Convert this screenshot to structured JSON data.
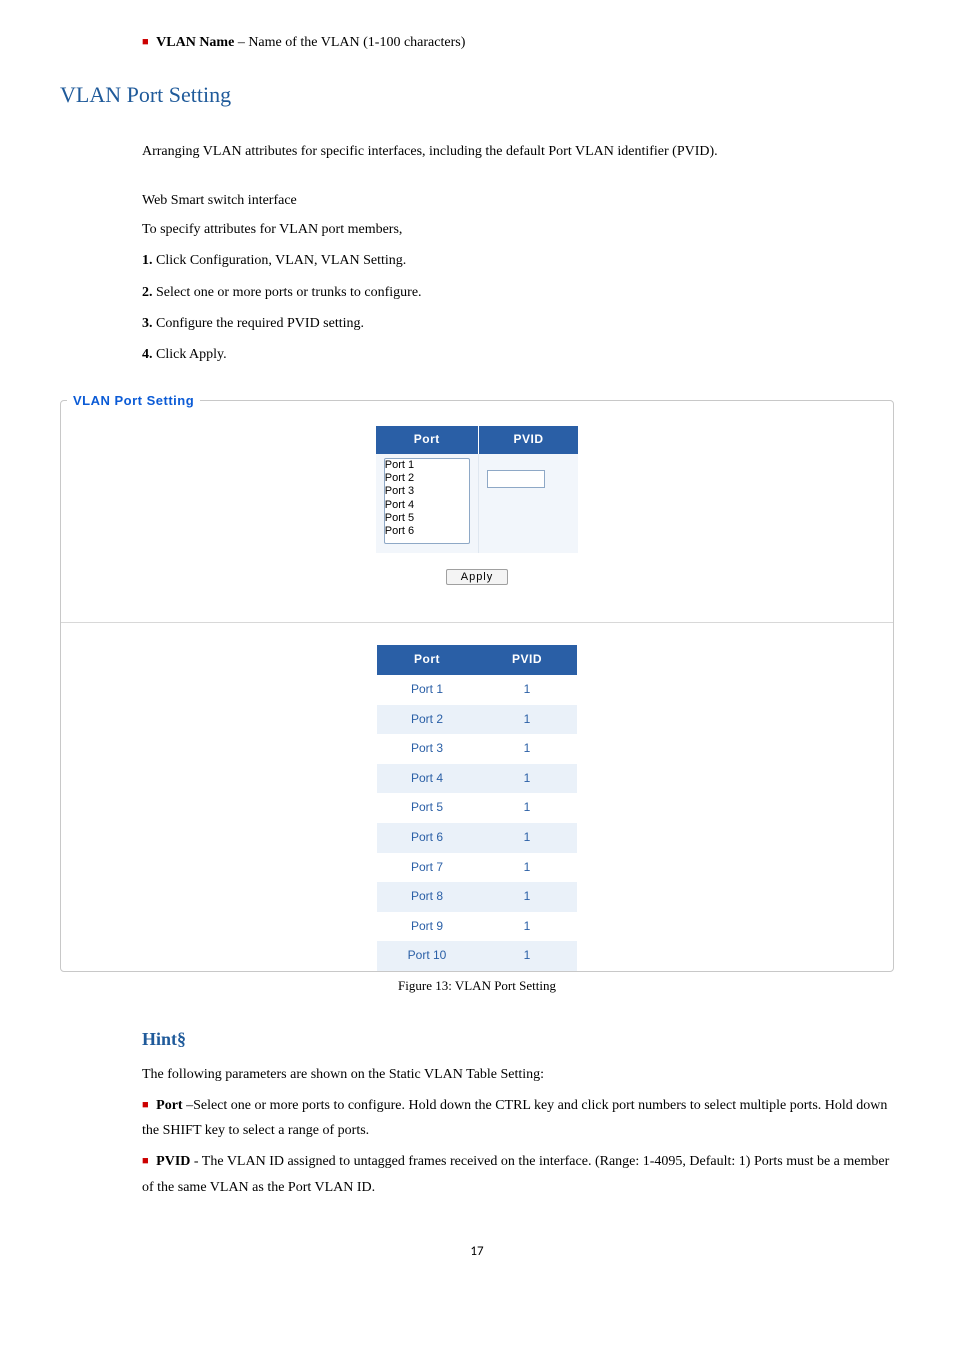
{
  "top_bullet": {
    "prefix": "■",
    "label": "VLAN Name",
    "desc": " – Name of the VLAN (1-100 characters)"
  },
  "section_title": "VLAN Port Setting",
  "intro": "Arranging VLAN attributes for specific interfaces, including the default Port VLAN identifier (PVID).",
  "sub_intro": "Web Smart switch interface",
  "sub_intro2": "To specify attributes for VLAN port members,",
  "steps": [
    {
      "n": "1.",
      "t": " Click Configuration, VLAN, VLAN Setting."
    },
    {
      "n": "2.",
      "t": " Select one or more ports or trunks to configure."
    },
    {
      "n": "3.",
      "t": " Configure the required PVID setting."
    },
    {
      "n": "4.",
      "t": " Click Apply."
    }
  ],
  "fieldset_legend": "VLAN Port Setting",
  "form_headers": {
    "port": "Port",
    "pvid": "PVID"
  },
  "port_options": [
    "Port 1",
    "Port 2",
    "Port 3",
    "Port 4",
    "Port 5",
    "Port 6"
  ],
  "pvid_value": "",
  "apply_label": "Apply",
  "status_headers": {
    "port": "Port",
    "pvid": "PVID"
  },
  "chart_data": {
    "type": "table",
    "title": "VLAN Port Setting status",
    "columns": [
      "Port",
      "PVID"
    ],
    "rows": [
      {
        "port": "Port 1",
        "pvid": "1"
      },
      {
        "port": "Port 2",
        "pvid": "1"
      },
      {
        "port": "Port 3",
        "pvid": "1"
      },
      {
        "port": "Port 4",
        "pvid": "1"
      },
      {
        "port": "Port 5",
        "pvid": "1"
      },
      {
        "port": "Port 6",
        "pvid": "1"
      },
      {
        "port": "Port 7",
        "pvid": "1"
      },
      {
        "port": "Port 8",
        "pvid": "1"
      },
      {
        "port": "Port 9",
        "pvid": "1"
      },
      {
        "port": "Port 10",
        "pvid": "1"
      }
    ]
  },
  "figure_caption": "Figure 13: VLAN Port Setting",
  "hint_heading": "Hint§",
  "hint_intro": "The following parameters are shown on the Static VLAN Table Setting:",
  "hint_items": [
    {
      "label": "Port",
      "desc": " –Select one or more ports to configure. Hold down the CTRL key and click port numbers to select multiple ports. Hold down the SHIFT key to select a range of ports."
    },
    {
      "label": "PVID",
      "desc": " - The VLAN ID assigned to untagged frames received on the interface. (Range: 1-4095, Default: 1) Ports must be a member of the same VLAN as the Port VLAN ID."
    }
  ],
  "page_number": "17"
}
